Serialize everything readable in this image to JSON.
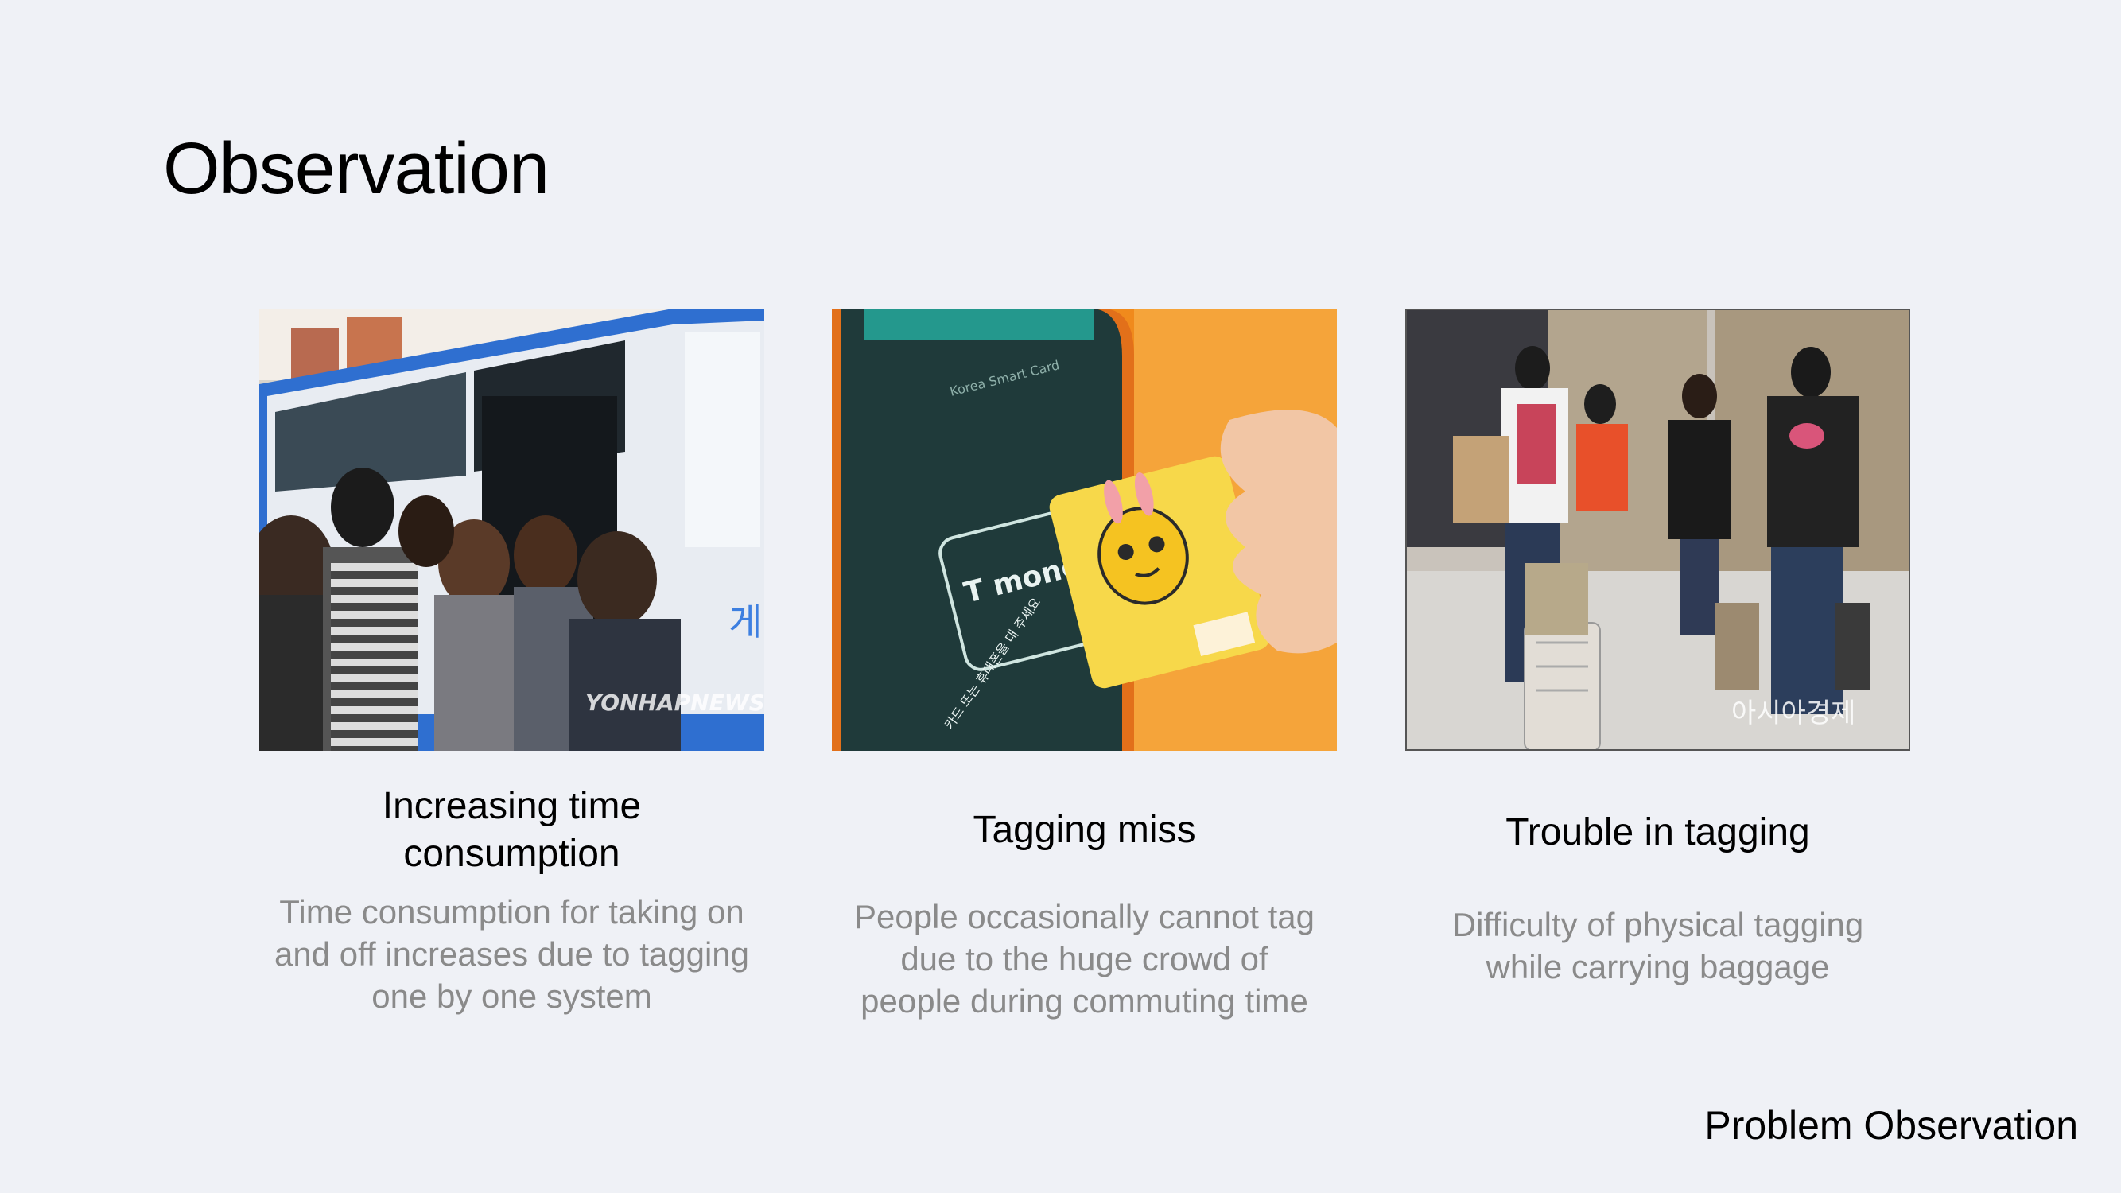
{
  "slide": {
    "title": "Observation",
    "footer": "Problem Observation"
  },
  "cards": [
    {
      "title_line1": "Increasing time",
      "title_line2": "consumption",
      "body_line1": "Time consumption for taking on",
      "body_line2": "and off increases due to tagging",
      "body_line3": "one by one system",
      "photo": {
        "watermark": "YONHAPNEWS",
        "bus_sign": "게 다"
      }
    },
    {
      "title_line1": "Tagging miss",
      "body_line1": "People occasionally cannot tag",
      "body_line2": "due to the huge crowd of",
      "body_line3": "people during commuting time",
      "photo": {
        "reader_header": "Korea Smart Card",
        "card_brand": "T money",
        "reader_footer": "카드 또는 휴대폰을 대 주세요"
      }
    },
    {
      "title_line1": "Trouble in tagging",
      "body_line1": "Difficulty of physical tagging",
      "body_line2": "while carrying baggage",
      "photo": {
        "watermark": "아시아경제"
      }
    }
  ],
  "colors": {
    "background": "#eff1f6",
    "title": "#000000",
    "body_text": "#8a8a8a",
    "bus_blue": "#2f6fd0",
    "card_yellow": "#f7d84a",
    "reader_orange": "#f08a1c"
  }
}
